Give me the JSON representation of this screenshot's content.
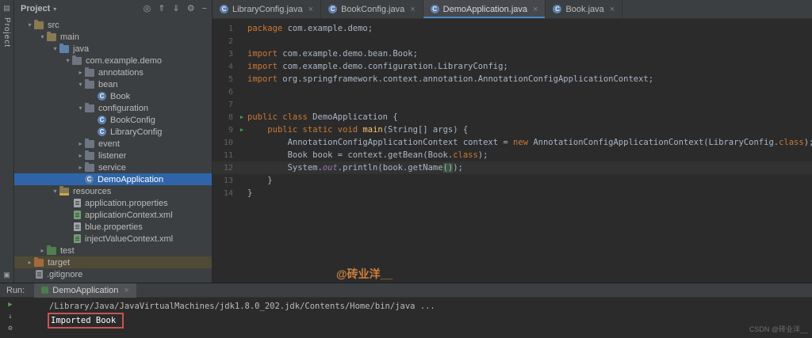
{
  "stripe": {
    "label": "Project"
  },
  "project": {
    "title": "Project",
    "header_icons": [
      {
        "name": "locate-icon",
        "glyph": "◎"
      },
      {
        "name": "collapse-all-icon",
        "glyph": "⇑"
      },
      {
        "name": "expand-all-icon",
        "glyph": "⇓"
      },
      {
        "name": "settings-icon",
        "glyph": "⚙"
      },
      {
        "name": "hide-panel-icon",
        "glyph": "−"
      }
    ],
    "tree": [
      {
        "label": "src",
        "indent": 1,
        "chevron": "v",
        "icon": "folder"
      },
      {
        "label": "main",
        "indent": 2,
        "chevron": "v",
        "icon": "folder"
      },
      {
        "label": "java",
        "indent": 3,
        "chevron": "v",
        "icon": "folder-src"
      },
      {
        "label": "com.example.demo",
        "indent": 4,
        "chevron": "v",
        "icon": "package"
      },
      {
        "label": "annotations",
        "indent": 5,
        "chevron": ">",
        "icon": "package"
      },
      {
        "label": "bean",
        "indent": 5,
        "chevron": "v",
        "icon": "package"
      },
      {
        "label": "Book",
        "indent": 6,
        "chevron": "",
        "icon": "class"
      },
      {
        "label": "configuration",
        "indent": 5,
        "chevron": "v",
        "icon": "package"
      },
      {
        "label": "BookConfig",
        "indent": 6,
        "chevron": "",
        "icon": "class"
      },
      {
        "label": "LibraryConfig",
        "indent": 6,
        "chevron": "",
        "icon": "class"
      },
      {
        "label": "event",
        "indent": 5,
        "chevron": ">",
        "icon": "package"
      },
      {
        "label": "listener",
        "indent": 5,
        "chevron": ">",
        "icon": "package"
      },
      {
        "label": "service",
        "indent": 5,
        "chevron": ">",
        "icon": "package"
      },
      {
        "label": "DemoApplication",
        "indent": 5,
        "chevron": "",
        "icon": "class",
        "selected": true
      },
      {
        "label": "resources",
        "indent": 3,
        "chevron": "v",
        "icon": "resources"
      },
      {
        "label": "application.properties",
        "indent": 4,
        "chevron": "",
        "icon": "properties"
      },
      {
        "label": "applicationContext.xml",
        "indent": 4,
        "chevron": "",
        "icon": "xml"
      },
      {
        "label": "blue.properties",
        "indent": 4,
        "chevron": "",
        "icon": "properties"
      },
      {
        "label": "injectValueContext.xml",
        "indent": 4,
        "chevron": "",
        "icon": "xml"
      },
      {
        "label": "test",
        "indent": 2,
        "chevron": ">",
        "icon": "folder-test"
      },
      {
        "label": "target",
        "indent": 1,
        "chevron": ">",
        "icon": "folder-excluded",
        "excluded": true
      },
      {
        "label": ".gitignore",
        "indent": 1,
        "chevron": "",
        "icon": "git"
      }
    ]
  },
  "editor": {
    "tabs": [
      {
        "label": "LibraryConfig.java",
        "active": false
      },
      {
        "label": "BookConfig.java",
        "active": false
      },
      {
        "label": "DemoApplication.java",
        "active": true
      },
      {
        "label": "Book.java",
        "active": false
      }
    ],
    "lines": [
      {
        "num": 1,
        "segments": [
          {
            "c": "kw",
            "t": "package"
          },
          {
            "c": "pl",
            "t": " com.example.demo;"
          }
        ]
      },
      {
        "num": 2,
        "segments": []
      },
      {
        "num": 3,
        "segments": [
          {
            "c": "kw",
            "t": "import"
          },
          {
            "c": "pl",
            "t": " com.example.demo.bean.Book;"
          }
        ]
      },
      {
        "num": 4,
        "segments": [
          {
            "c": "kw",
            "t": "import"
          },
          {
            "c": "pl",
            "t": " com.example.demo.configuration.LibraryConfig;"
          }
        ]
      },
      {
        "num": 5,
        "segments": [
          {
            "c": "kw",
            "t": "import"
          },
          {
            "c": "pl",
            "t": " org.springframework.context.annotation.AnnotationConfigApplicationContext;"
          }
        ]
      },
      {
        "num": 6,
        "segments": []
      },
      {
        "num": 7,
        "segments": []
      },
      {
        "num": 8,
        "run": true,
        "segments": [
          {
            "c": "kw",
            "t": "public class"
          },
          {
            "c": "pl",
            "t": " DemoApplication {"
          }
        ]
      },
      {
        "num": 9,
        "run": true,
        "segments": [
          {
            "c": "pl",
            "t": "    "
          },
          {
            "c": "kw",
            "t": "public static void"
          },
          {
            "c": "pl",
            "t": " "
          },
          {
            "c": "fn",
            "t": "main"
          },
          {
            "c": "pl",
            "t": "(String[] args) {"
          }
        ]
      },
      {
        "num": 10,
        "segments": [
          {
            "c": "pl",
            "t": "        AnnotationConfigApplicationContext context = "
          },
          {
            "c": "kw",
            "t": "new"
          },
          {
            "c": "pl",
            "t": " AnnotationConfigApplicationContext(LibraryConfig."
          },
          {
            "c": "kw",
            "t": "class"
          },
          {
            "c": "pl",
            "t": ");"
          }
        ]
      },
      {
        "num": 11,
        "segments": [
          {
            "c": "pl",
            "t": "        Book book = context.getBean(Book."
          },
          {
            "c": "kw",
            "t": "class"
          },
          {
            "c": "pl",
            "t": ");"
          }
        ]
      },
      {
        "num": 12,
        "current": true,
        "segments": [
          {
            "c": "pl",
            "t": "        System."
          },
          {
            "c": "fld",
            "t": "out"
          },
          {
            "c": "pl",
            "t": ".println(book.getName"
          },
          {
            "c": "paren",
            "t": "()"
          },
          {
            "c": "pl",
            "t": ");"
          }
        ]
      },
      {
        "num": 13,
        "segments": [
          {
            "c": "pl",
            "t": "    }"
          }
        ]
      },
      {
        "num": 14,
        "segments": [
          {
            "c": "pl",
            "t": "}"
          }
        ]
      }
    ]
  },
  "run": {
    "label": "Run:",
    "tab": "DemoApplication",
    "toolbar_icons": [
      {
        "name": "rerun-icon",
        "glyph": "▶",
        "color": "#5c9e54"
      },
      {
        "name": "scroll-down-icon",
        "glyph": "↓",
        "color": "#9da0a3"
      },
      {
        "name": "run-settings-icon",
        "glyph": "⚙",
        "color": "#9da0a3"
      }
    ],
    "console": [
      "/Library/Java/JavaVirtualMachines/jdk1.8.0_202.jdk/Contents/Home/bin/java ...",
      "Imported Book"
    ]
  },
  "watermark": {
    "center": "@砖业洋__",
    "corner": "CSDN @砖业洋__"
  },
  "colors": {
    "selection": "#2f65a8",
    "keyword": "#cc7832",
    "highlight_box": "#c75450",
    "run_icon_green": "#499c54"
  }
}
